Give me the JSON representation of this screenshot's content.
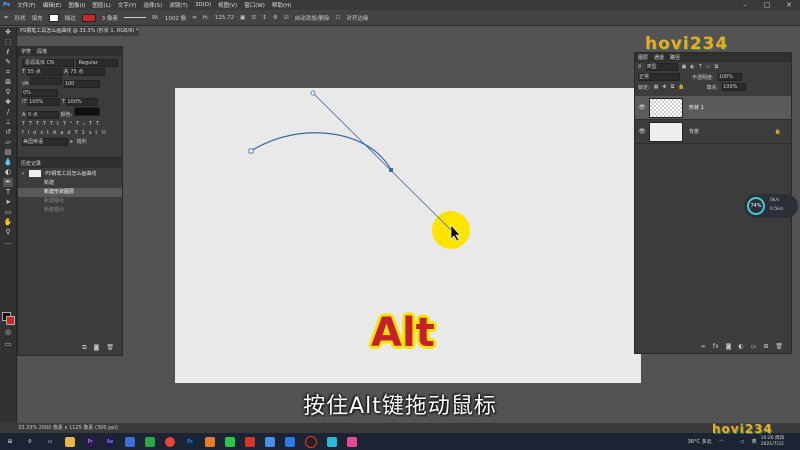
{
  "menu": [
    "文件(F)",
    "编辑(E)",
    "图像(I)",
    "图层(L)",
    "文字(Y)",
    "选择(S)",
    "滤镜(T)",
    "3D(D)",
    "视图(V)",
    "窗口(W)",
    "帮助(H)"
  ],
  "options": {
    "shape": "形状",
    "fill": "填充",
    "stroke": "描边",
    "stroke_width": "3 像素",
    "w": "1002 像",
    "h": "125.72",
    "auto_add": "自动添加/删除",
    "align": "对齐边缘"
  },
  "document_tab": "PS钢笔工具怎么画曲线 @ 33.3% (形状 1, RGB/8) *",
  "character_panel": {
    "tabs": [
      "字符",
      "段落"
    ],
    "font": "思源黑体 CN",
    "style": "Regular",
    "size": "55 点",
    "leading": "75 点",
    "tracking_label": "VA",
    "tracking": "100",
    "kerning": "0%",
    "scale_v": "100%",
    "scale_h": "100%",
    "baseline": "0 点",
    "color_label": "颜色:",
    "lang": "美国英语",
    "aa": "锐利"
  },
  "history_panel": {
    "tab": "历史记录",
    "doc": "PS钢笔工具怎么画曲线",
    "items": [
      "新建",
      "新建形状图层",
      "新建锚点",
      "新建锚点"
    ]
  },
  "layers_panel": {
    "tabs": [
      "图层",
      "通道",
      "路径"
    ],
    "kind": "类型",
    "mode": "正常",
    "opacity_label": "不透明度:",
    "opacity": "100%",
    "lock_label": "锁定:",
    "fill_label": "填充:",
    "fill": "100%",
    "layers": [
      {
        "name": "形状 1"
      },
      {
        "name": "背景"
      }
    ]
  },
  "overlay_text": "Alt",
  "caption": "按住Alt键拖动鼠标",
  "logo": "hovi234",
  "status": "33.33%  2000 像素 x 1125 像素 (300 ppi)",
  "meter": {
    "percent": "74%",
    "up": "0k/s",
    "down": "0.5k/s"
  },
  "tray": {
    "weather": "36°C 多云",
    "time": "10:26 周四",
    "date": "2021/7/22",
    "lang": "英"
  },
  "colors": {
    "canvas": "#e9e9e9",
    "path": "#3c6aa8",
    "highlight": "#ffe400",
    "alt_red": "#c8202a"
  }
}
